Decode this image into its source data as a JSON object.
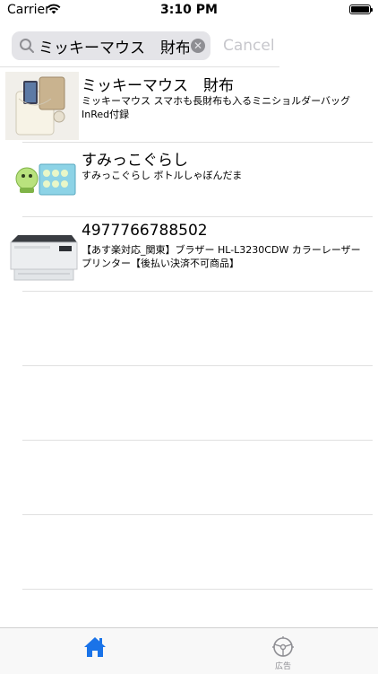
{
  "status_bar": {
    "carrier": "Carrier",
    "time": "3:10 PM"
  },
  "search": {
    "value": "ミッキーマウス　財布",
    "cancel_label": "Cancel"
  },
  "results": [
    {
      "title": "ミッキーマウス　財布",
      "description": "ミッキーマウス スマホも長財布も入るミニショルダーバッグ InRed付録"
    },
    {
      "title": "すみっこぐらし",
      "description": "すみっこぐらし ボトルしゃぼんだま"
    },
    {
      "title": "4977766788502",
      "description": "【あす楽対応_関東】ブラザー HL-L3230CDW カラーレーザープリンター【後払い決済不可商品】"
    }
  ],
  "tab_bar": {
    "items": [
      {
        "name": "home",
        "label": "",
        "icon": "home-icon",
        "selected": true
      },
      {
        "name": "ad",
        "label": "広告",
        "icon": "steering-wheel-icon",
        "selected": false
      }
    ]
  },
  "colors": {
    "accent": "#1a73e8",
    "inactive": "#8e8e93",
    "separator": "#e0e0e0"
  }
}
